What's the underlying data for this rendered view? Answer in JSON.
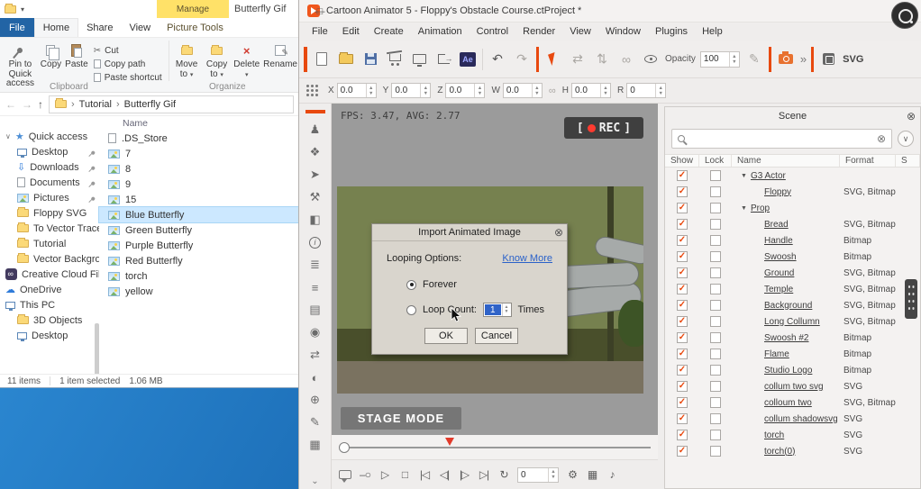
{
  "explorer": {
    "window_title": "Butterfly Gif",
    "contextual_tab": "Manage",
    "tabs": [
      {
        "label": "File",
        "type": "file"
      },
      {
        "label": "Home",
        "active": true
      },
      {
        "label": "Share"
      },
      {
        "label": "View"
      },
      {
        "label": "Picture Tools",
        "contextual": true
      }
    ],
    "ribbon": {
      "pin_quick_access": "Pin to Quick access",
      "copy": "Copy",
      "paste": "Paste",
      "cut": "Cut",
      "copy_path": "Copy path",
      "paste_shortcut": "Paste shortcut",
      "clipboard_group": "Clipboard",
      "move_to": "Move to",
      "copy_to": "Copy to",
      "delete": "Delete",
      "rename": "Rename",
      "organize_group": "Organize"
    },
    "breadcrumb": [
      "Tutorial",
      "Butterfly Gif"
    ],
    "sidebar": [
      {
        "label": "Quick access",
        "icon": "star",
        "indent": 0,
        "chevron": true
      },
      {
        "label": "Desktop",
        "icon": "monitor",
        "indent": 1,
        "pinned": true
      },
      {
        "label": "Downloads",
        "icon": "download",
        "indent": 1,
        "pinned": true
      },
      {
        "label": "Documents",
        "icon": "doc",
        "indent": 1,
        "pinned": true
      },
      {
        "label": "Pictures",
        "icon": "pic",
        "indent": 1,
        "pinned": true
      },
      {
        "label": "Floppy SVG",
        "icon": "folder",
        "indent": 1
      },
      {
        "label": "To Vector Trace",
        "icon": "folder",
        "indent": 1
      },
      {
        "label": "Tutorial",
        "icon": "folder",
        "indent": 1
      },
      {
        "label": "Vector Backgrou",
        "icon": "folder",
        "indent": 1
      },
      {
        "label": "Creative Cloud Fil",
        "icon": "cc",
        "indent": 0
      },
      {
        "label": "OneDrive",
        "icon": "cloud",
        "indent": 0
      },
      {
        "label": "This PC",
        "icon": "pc",
        "indent": 0
      },
      {
        "label": "3D Objects",
        "icon": "folder",
        "indent": 1
      },
      {
        "label": "Desktop",
        "icon": "monitor",
        "indent": 1
      }
    ],
    "files": {
      "column_header": "Name",
      "items": [
        {
          "name": ".DS_Store",
          "icon": "file"
        },
        {
          "name": "7",
          "icon": "image"
        },
        {
          "name": "8",
          "icon": "image"
        },
        {
          "name": "9",
          "icon": "image"
        },
        {
          "name": "15",
          "icon": "image"
        },
        {
          "name": "Blue Butterfly",
          "icon": "image",
          "selected": true
        },
        {
          "name": "Green Butterfly",
          "icon": "image"
        },
        {
          "name": "Purple Butterfly",
          "icon": "image"
        },
        {
          "name": "Red Butterfly",
          "icon": "image"
        },
        {
          "name": "torch",
          "icon": "image"
        },
        {
          "name": "yellow",
          "icon": "image"
        }
      ]
    },
    "status": {
      "items_count": "11 items",
      "selection": "1 item selected",
      "size": "1.06 MB"
    }
  },
  "ca": {
    "window_title": "Cartoon Animator 5 - Floppy's Obstacle Course.ctProject *",
    "menus": [
      "File",
      "Edit",
      "Create",
      "Animation",
      "Control",
      "Render",
      "View",
      "Window",
      "Plugins",
      "Help"
    ],
    "toolbar": {
      "opacity_label": "Opacity",
      "opacity_value": "100",
      "more_glyph": "»",
      "svg_label": "SVG",
      "items": [
        {
          "t": "icon",
          "name": "new-project-icon",
          "cls": "i-pagebig"
        },
        {
          "t": "icon",
          "name": "open-project-icon",
          "cls": "i-folderbig"
        },
        {
          "t": "icon",
          "name": "save-project-icon",
          "cls": "i-save"
        },
        {
          "t": "icon",
          "name": "content-store-icon",
          "cls": "i-cart"
        },
        {
          "t": "icon",
          "name": "export-screen-icon",
          "cls": "i-monitorbig"
        },
        {
          "t": "icon",
          "name": "export-media-icon",
          "cls": "i-export"
        },
        {
          "t": "icon",
          "name": "after-effects-icon",
          "cls": "i-ae",
          "text": "Ae"
        },
        {
          "t": "sep"
        },
        {
          "t": "icon",
          "name": "undo-icon",
          "g": "↶"
        },
        {
          "t": "icon",
          "name": "redo-icon",
          "g": "↷",
          "dim": true
        },
        {
          "t": "osep"
        },
        {
          "t": "icon",
          "name": "select-tool-icon",
          "cls": "i-cursor"
        },
        {
          "t": "icon",
          "name": "flip-horizontal-icon",
          "g": "⇄",
          "dim": true
        },
        {
          "t": "icon",
          "name": "flip-vertical-icon",
          "g": "⇅",
          "dim": true
        },
        {
          "t": "icon",
          "name": "link-icon",
          "g": "∞",
          "dim": true
        },
        {
          "t": "icon",
          "name": "visibility-eye-icon",
          "cls": "i-eye"
        },
        {
          "t": "label",
          "name": "opacity-label",
          "bind": "opacity_label"
        },
        {
          "t": "field",
          "name": "opacity-field",
          "bind": "opacity_value"
        },
        {
          "t": "icon",
          "name": "paint-icon",
          "g": "✎",
          "dim": true
        },
        {
          "t": "osep"
        },
        {
          "t": "icon",
          "name": "render-camera-icon",
          "cls": "i-camera"
        },
        {
          "t": "label",
          "name": "more-tools-chevron",
          "bind": "more_glyph"
        },
        {
          "t": "osep"
        },
        {
          "t": "icon",
          "name": "svg-badge-icon",
          "cls": "i-svgbadge"
        },
        {
          "t": "label",
          "name": "svg-label",
          "bind": "svg_label"
        }
      ]
    },
    "transform": {
      "fields": [
        {
          "label": "X",
          "value": "0.0"
        },
        {
          "label": "Y",
          "value": "0.0"
        },
        {
          "label": "Z",
          "value": "0.0"
        },
        {
          "label": "W",
          "value": "0.0"
        },
        {
          "label": "H",
          "value": "0.0"
        },
        {
          "label": "R",
          "value": "0"
        }
      ]
    },
    "tools": [
      {
        "name": "actor-tool-icon",
        "g": "♟"
      },
      {
        "name": "wardrobe-tool-icon",
        "g": "❖"
      },
      {
        "name": "motion-tool-icon",
        "g": "➤"
      },
      {
        "name": "prop-tool-icon",
        "g": "⚒"
      },
      {
        "name": "sprite-tool-icon",
        "g": "◧"
      },
      {
        "name": "info-tool-icon",
        "cls": "i-info",
        "text": "i"
      },
      {
        "name": "adjust-tool-icon",
        "g": "≣"
      },
      {
        "name": "script-tool-icon",
        "g": "≡"
      },
      {
        "name": "layer-tool-icon",
        "g": "▤"
      },
      {
        "name": "camera-tool-icon",
        "g": "◉"
      },
      {
        "name": "flip-tool-icon",
        "g": "⇄"
      },
      {
        "name": "mask-tool-icon",
        "g": "◐"
      },
      {
        "name": "collect-tool-icon",
        "g": "⊕"
      },
      {
        "name": "paint-tool-icon",
        "g": "✎"
      },
      {
        "name": "grid-tool-icon",
        "g": "▦"
      }
    ],
    "viewport": {
      "fps": "FPS: 3.47, AVG: 2.77",
      "rec_open": "[",
      "rec_label": "REC",
      "rec_close": "]",
      "stage_mode": "STAGE MODE"
    },
    "dialog": {
      "title": "Import Animated Image",
      "looping_options": "Looping Options:",
      "know_more": "Know More",
      "forever": "Forever",
      "loop_count": "Loop Count:",
      "loop_value": "1",
      "times": "Times",
      "ok": "OK",
      "cancel": "Cancel"
    },
    "transport": {
      "frame_value": "0",
      "items": [
        {
          "t": "icon",
          "name": "comment-icon",
          "cls": "i-bubble"
        },
        {
          "t": "icon",
          "name": "marker-icon",
          "g": "–○"
        },
        {
          "t": "icon",
          "name": "play-button",
          "g": "▷"
        },
        {
          "t": "icon",
          "name": "stop-button",
          "g": "□"
        },
        {
          "t": "icon",
          "name": "first-frame-button",
          "g": "|◁"
        },
        {
          "t": "icon",
          "name": "prev-frame-button",
          "g": "◁|"
        },
        {
          "t": "icon",
          "name": "next-frame-button",
          "g": "|▷"
        },
        {
          "t": "icon",
          "name": "last-frame-button",
          "g": "▷|"
        },
        {
          "t": "icon",
          "name": "loop-button",
          "g": "↻"
        },
        {
          "t": "field",
          "name": "frame-field",
          "bind": "frame_value"
        },
        {
          "t": "icon",
          "name": "settings-button",
          "g": "⚙"
        },
        {
          "t": "icon",
          "name": "grid-view-button",
          "g": "▦"
        },
        {
          "t": "icon",
          "name": "audio-button",
          "g": "♪"
        }
      ]
    }
  },
  "scene": {
    "title": "Scene",
    "columns": [
      "Show",
      "Lock",
      "Name",
      "Format",
      "S"
    ],
    "rows": [
      {
        "name": "G3 Actor",
        "format": "",
        "show": true,
        "group": true
      },
      {
        "name": "Floppy",
        "format": "SVG, Bitmap",
        "show": true
      },
      {
        "name": "Prop",
        "format": "",
        "show": true,
        "group": true
      },
      {
        "name": "Bread",
        "format": "SVG, Bitmap",
        "show": true
      },
      {
        "name": "Handle",
        "format": "Bitmap",
        "show": true
      },
      {
        "name": "Swoosh",
        "format": "Bitmap",
        "show": true
      },
      {
        "name": "Ground",
        "format": "SVG, Bitmap",
        "show": true
      },
      {
        "name": "Temple",
        "format": "SVG, Bitmap",
        "show": true
      },
      {
        "name": "Background",
        "format": "SVG, Bitmap",
        "show": true
      },
      {
        "name": "Long Collumn",
        "format": "SVG, Bitmap",
        "show": true
      },
      {
        "name": "Swoosh #2",
        "format": "Bitmap",
        "show": true
      },
      {
        "name": "Flame",
        "format": "Bitmap",
        "show": true
      },
      {
        "name": "Studio Logo",
        "format": "Bitmap",
        "show": true
      },
      {
        "name": "collum two svg",
        "format": "SVG",
        "show": true
      },
      {
        "name": "colloum two",
        "format": "SVG, Bitmap",
        "show": true
      },
      {
        "name": "collum shadowsvg",
        "format": "SVG",
        "show": true
      },
      {
        "name": "torch",
        "format": "SVG",
        "show": true
      },
      {
        "name": "torch(0)",
        "format": "SVG",
        "show": true
      }
    ]
  }
}
